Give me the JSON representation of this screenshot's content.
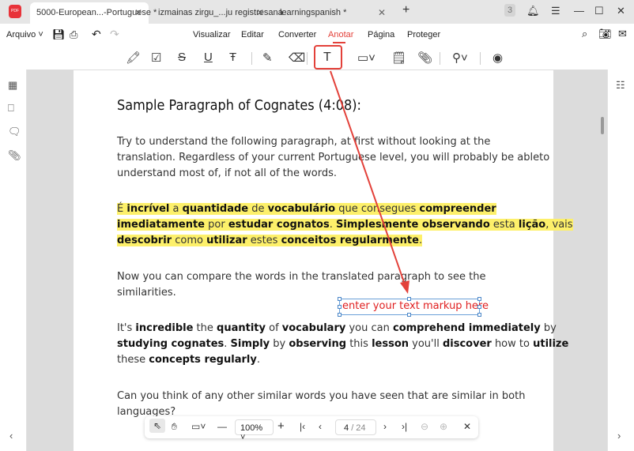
{
  "tabs": [
    {
      "label": "5000-European...-Portuguese *"
    },
    {
      "label": "izmainas zirgu_...ju registresana"
    },
    {
      "label": "learningspanish *"
    }
  ],
  "tab_count": "3",
  "menu": {
    "file": "Arquivo",
    "items": [
      "Visualizar",
      "Editar",
      "Converter",
      "Anotar",
      "Página",
      "Proteger"
    ],
    "active": "Anotar"
  },
  "accent": "#e3413a",
  "document": {
    "heading": "Sample Paragraph of Cognates (4:08):",
    "p1": [
      "Try to understand the following paragraph, at first without looking at the",
      "translation. Regardless of your current Portuguese level, you will probably be ableto",
      "understand most of, if not all of the words."
    ],
    "p2": [
      [
        [
          "É ",
          0
        ],
        [
          "incrível",
          1
        ],
        [
          " a ",
          0
        ],
        [
          "quantidade",
          1
        ],
        [
          " de ",
          0
        ],
        [
          "vocabulário",
          1
        ],
        [
          " que consegues ",
          0
        ],
        [
          "compreender",
          1
        ]
      ],
      [
        [
          "imediatamente",
          1
        ],
        [
          " por ",
          0
        ],
        [
          "estudar cognatos",
          1
        ],
        [
          ". ",
          0
        ],
        [
          "Simplesmente observando",
          1
        ],
        [
          " esta ",
          0
        ],
        [
          "lição",
          1
        ],
        [
          ", vais",
          0
        ]
      ],
      [
        [
          "descobrir",
          1
        ],
        [
          " como ",
          0
        ],
        [
          "utilizar",
          1
        ],
        [
          " estes ",
          0
        ],
        [
          "conceitos regularmente",
          1
        ],
        [
          ".",
          0
        ]
      ]
    ],
    "p3": [
      "Now you can compare the words in the translated paragraph to see the",
      "similarities."
    ],
    "p4": [
      [
        [
          "It's ",
          0
        ],
        [
          "incredible",
          1
        ],
        [
          " the ",
          0
        ],
        [
          "quantity",
          1
        ],
        [
          " of ",
          0
        ],
        [
          "vocabulary",
          1
        ],
        [
          " you can ",
          0
        ],
        [
          "comprehend immediately",
          1
        ],
        [
          " by",
          0
        ]
      ],
      [
        [
          "studying cognates",
          1
        ],
        [
          ". ",
          0
        ],
        [
          "Simply",
          1
        ],
        [
          " by ",
          0
        ],
        [
          "observing",
          1
        ],
        [
          " this ",
          0
        ],
        [
          "lesson",
          1
        ],
        [
          " you'll ",
          0
        ],
        [
          "discover",
          1
        ],
        [
          " how to ",
          0
        ],
        [
          "utilize",
          1
        ]
      ],
      [
        [
          "these ",
          0
        ],
        [
          "concepts regularly",
          1
        ],
        [
          ".",
          0
        ]
      ]
    ],
    "p5": [
      "Can you think of any other similar words you have seen that are similar in both",
      "languages?"
    ],
    "markup_text": "enter your text markup here"
  },
  "bottom": {
    "zoom": "100%",
    "page": "4",
    "total": "/ 24"
  }
}
